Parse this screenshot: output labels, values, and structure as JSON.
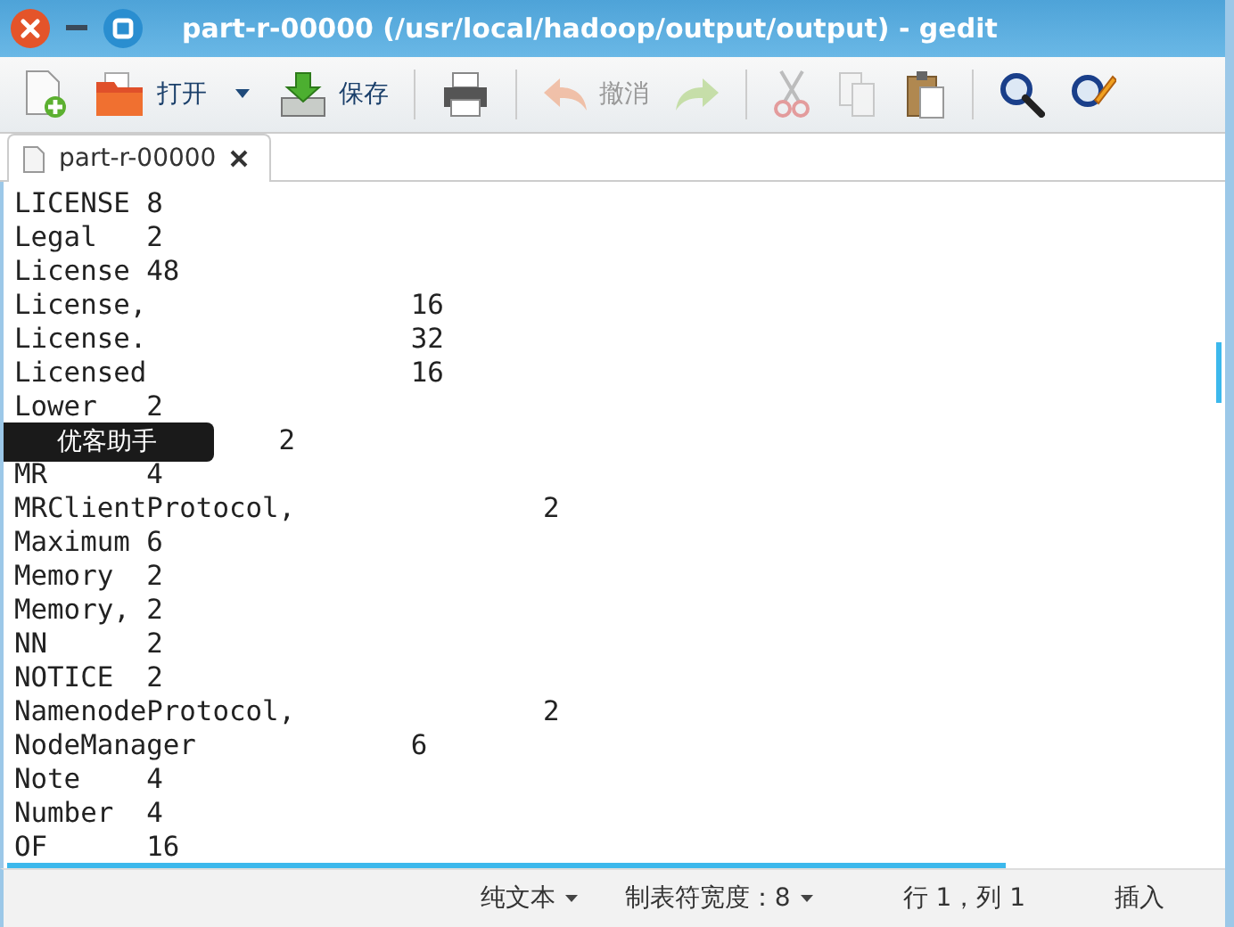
{
  "window": {
    "title": "part-r-00000 (/usr/local/hadoop/output/output) - gedit"
  },
  "toolbar": [
    {
      "kind": "new",
      "disabled": false
    },
    {
      "kind": "open",
      "label": "打开",
      "disabled": false
    },
    {
      "kind": "menu",
      "disabled": false
    },
    {
      "kind": "save",
      "label": "保存",
      "disabled": false
    },
    {
      "kind": "separator"
    },
    {
      "kind": "print",
      "disabled": false
    },
    {
      "kind": "separator"
    },
    {
      "kind": "undo",
      "label": "撤消",
      "disabled": true
    },
    {
      "kind": "redo",
      "disabled": true
    },
    {
      "kind": "separator"
    },
    {
      "kind": "cut",
      "disabled": true
    },
    {
      "kind": "copy",
      "disabled": true
    },
    {
      "kind": "paste",
      "disabled": false
    },
    {
      "kind": "separator"
    },
    {
      "kind": "find",
      "disabled": false
    },
    {
      "kind": "replace",
      "disabled": false
    }
  ],
  "tabs": [
    {
      "label": "part-r-00000",
      "selected": true
    }
  ],
  "lines": [
    "LICENSE\t8",
    "Legal\t2",
    "License\t48",
    "License,\t\t16",
    "License.\t\t32",
    "Licensed\t\t16",
    "Lower\t2",
    "\t\t2",
    "MR\t4",
    "MRClientProtocol,\t\t2",
    "Maximum\t6",
    "Memory\t2",
    "Memory,\t2",
    "NN\t2",
    "NOTICE\t2",
    "NamenodeProtocol,\t\t2",
    "NodeManager\t\t6",
    "Note\t4",
    "Number\t4",
    "OF\t16"
  ],
  "tooltip": {
    "text": "优客助手"
  },
  "status_bar": [
    {
      "text": "纯文本",
      "dropdown": true
    },
    {
      "text": "制表符宽度：8",
      "dropdown": true
    },
    {
      "text": "行 1，列 1",
      "dropdown": false
    },
    {
      "text": "插入",
      "dropdown": false
    }
  ]
}
